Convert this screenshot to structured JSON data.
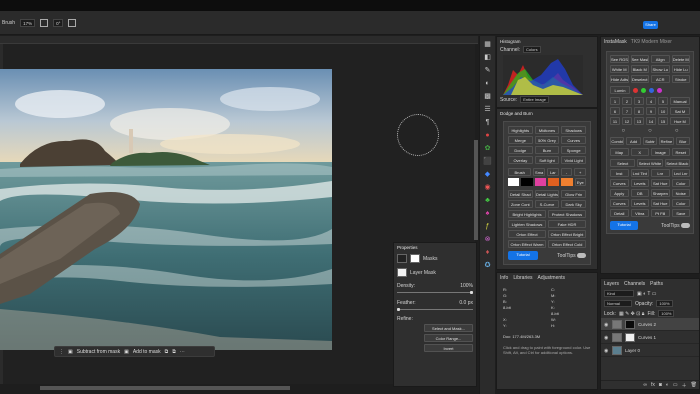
{
  "options_bar": {
    "size_label": "Brush",
    "zoom_value": "17%",
    "angle_value": "0°",
    "share_label": "Share"
  },
  "mask_bar": {
    "subtract_label": "Subtract from mask",
    "add_label": "Add to mask"
  },
  "histogram": {
    "tab": "Histogram",
    "channel_label": "Channel:",
    "channel_value": "Colors",
    "source_label": "Source:",
    "source_value": "Entire Image"
  },
  "dodge_burn": {
    "title": "Dodge and Burn",
    "row1": [
      "Highlights",
      "Midtones",
      "Shadows"
    ],
    "row2": [
      "Merge",
      "50% Grey",
      "Curves"
    ],
    "row3": [
      "Dodge",
      "Burn",
      "Sponge"
    ],
    "row4": [
      "Overlay",
      "Soft light",
      "Vivid Light"
    ],
    "brush_row": [
      "Brush",
      "Sma",
      "Lar",
      "-",
      "+"
    ],
    "swatches": [
      "#ffffff",
      "#000000",
      "#e040a0",
      "#e06020",
      "#f08030"
    ],
    "eye_label": "Eye",
    "row5": [
      "Detail Shad",
      "Detail Lights",
      "Glow Frin"
    ],
    "row6": [
      "Zone Cont",
      "S-Curve",
      "Dark Sky"
    ],
    "row7": [
      "Bright Highlights",
      "Protect Shadows"
    ],
    "row8": [
      "Lighten Shadows",
      "Fake HDR"
    ],
    "row9": [
      "Orton Effect",
      "Orton Effect Bright"
    ],
    "row10": [
      "Orton Effect Warm",
      "Orton Effect Cold"
    ],
    "tutorial_label": "Tutorial",
    "tooltips_label": "ToolTips"
  },
  "properties": {
    "title": "Properties",
    "mask_label": "Masks",
    "layer_mask_label": "Layer Mask",
    "density_label": "Density:",
    "density_value": "100%",
    "feather_label": "Feather:",
    "feather_value": "0.0 px",
    "refine_label": "Refine:",
    "select_mask_label": "Select and Mask...",
    "color_range_label": "Color Range...",
    "invert_label": "Invert"
  },
  "info_panel": {
    "tabs": [
      "Info",
      "Libraries",
      "Adjustments"
    ],
    "r_label": "R:",
    "g_label": "G:",
    "b_label": "B:",
    "c_label": "C:",
    "m_label": "M:",
    "y_label": "Y:",
    "k_label": "K:",
    "bit_left": "8-bit",
    "bit_right": "8-bit",
    "x_label": "X:",
    "y_coord_label": "Y:",
    "w_label": "W:",
    "h_label": "H:",
    "doc_label": "Doc: 177.4M/263.3M",
    "hint": "Click and drag to paint with foreground color. Use Shift, Alt, and Ctrl for additional options."
  },
  "hdr_panel": {
    "tabs": [
      "InstaMask",
      "TK9 Modern Mixer"
    ],
    "row1": [
      "See RGS",
      "See Mask",
      "Align",
      "Delete M"
    ],
    "row2": [
      "White M",
      "Black M",
      "Show Lu",
      "Hide Lu"
    ],
    "row3": [
      "Hide Adts",
      "Deselect",
      "ACR",
      "Stroke"
    ],
    "lumin_label": "Lumin",
    "grid_numbers": [
      "1",
      "2",
      "3",
      "4",
      "5",
      "6",
      "7",
      "8",
      "9",
      "10",
      "11",
      "12",
      "13",
      "14",
      "15"
    ],
    "manual_label": "Manual",
    "sat_m_label": "Sat M",
    "hue_m_label": "Hue M",
    "combi_row": [
      "Combi",
      "Add",
      "Subtr",
      "Refine",
      "Blur"
    ],
    "map_row": [
      "Map",
      "X",
      "Image",
      "Reset"
    ],
    "sel_row": [
      "Select",
      "Select White",
      "Select Black"
    ],
    "btn_grid": [
      [
        "Inst",
        "Lnd Tint",
        "Lnr",
        "Lnd Lnr"
      ],
      [
        "Curves",
        "Levels",
        "Sat Hue",
        "Color"
      ],
      [
        "Apply",
        "DB",
        "Sharpen",
        "Noise"
      ],
      [
        "Curves",
        "Levels",
        "Sat Hue",
        "Color"
      ],
      [
        "Detail",
        "Vibra",
        "Pt Fill",
        "Save"
      ],
      [
        "Save",
        "Insta",
        "Recovery",
        "Info"
      ]
    ],
    "tutorial_label": "Tutorial",
    "tooltips_label": "ToolTips"
  },
  "layers": {
    "tabs": [
      "Layers",
      "Channels",
      "Paths"
    ],
    "kind_label": "Kind",
    "blend_mode": "Normal",
    "opacity_label": "Opacity:",
    "opacity_value": "100%",
    "lock_label": "Lock:",
    "fill_label": "Fill:",
    "fill_value": "100%",
    "items": [
      {
        "name": "Curves 2",
        "selected": true
      },
      {
        "name": "Curves 1",
        "selected": false
      },
      {
        "name": "Layer 0",
        "selected": false
      }
    ]
  }
}
